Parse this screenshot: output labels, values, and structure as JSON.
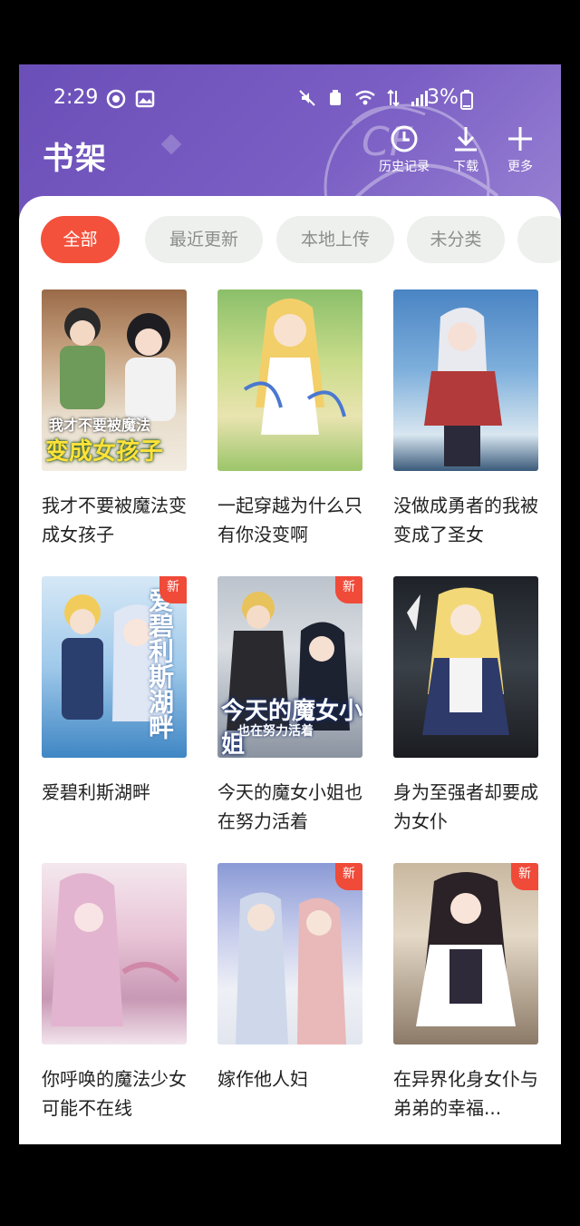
{
  "status": {
    "time": "2:29",
    "battery": "3%"
  },
  "header": {
    "title": "书架",
    "actions": [
      {
        "label": "历史记录",
        "icon": "clock-icon"
      },
      {
        "label": "下载",
        "icon": "download-icon"
      },
      {
        "label": "更多",
        "icon": "plus-icon"
      }
    ]
  },
  "tabs": [
    {
      "label": "全部",
      "active": true
    },
    {
      "label": "最近更新",
      "active": false
    },
    {
      "label": "本地上传",
      "active": false
    },
    {
      "label": "未分类",
      "active": false
    }
  ],
  "badge_text": "新",
  "books": [
    {
      "title": "我才不要被魔法变成女孩子",
      "new": false,
      "cover_caption_1": "我才不要被魔法",
      "cover_caption_2": "变成女孩子"
    },
    {
      "title": "一起穿越为什么只有你没变啊",
      "new": false
    },
    {
      "title": "没做成勇者的我被变成了圣女",
      "new": false
    },
    {
      "title": "爱碧利斯湖畔",
      "new": true,
      "cover_caption": "爱碧利斯湖畔"
    },
    {
      "title": "今天的魔女小姐也在努力活着",
      "new": true,
      "cover_caption_1": "今天的魔女小姐",
      "cover_caption_2": "也在努力活着"
    },
    {
      "title": "身为至强者却要成为女仆",
      "new": false
    },
    {
      "title": "你呼唤的魔法少女可能不在线",
      "new": false
    },
    {
      "title": "嫁作他人妇",
      "new": true
    },
    {
      "title": "在异界化身女仆与弟弟的幸福...",
      "new": true
    }
  ],
  "colors": {
    "header": "#7a5ec4",
    "accent": "#f4513c",
    "tab_bg": "#eef0ee",
    "badge": "#f04a39"
  }
}
